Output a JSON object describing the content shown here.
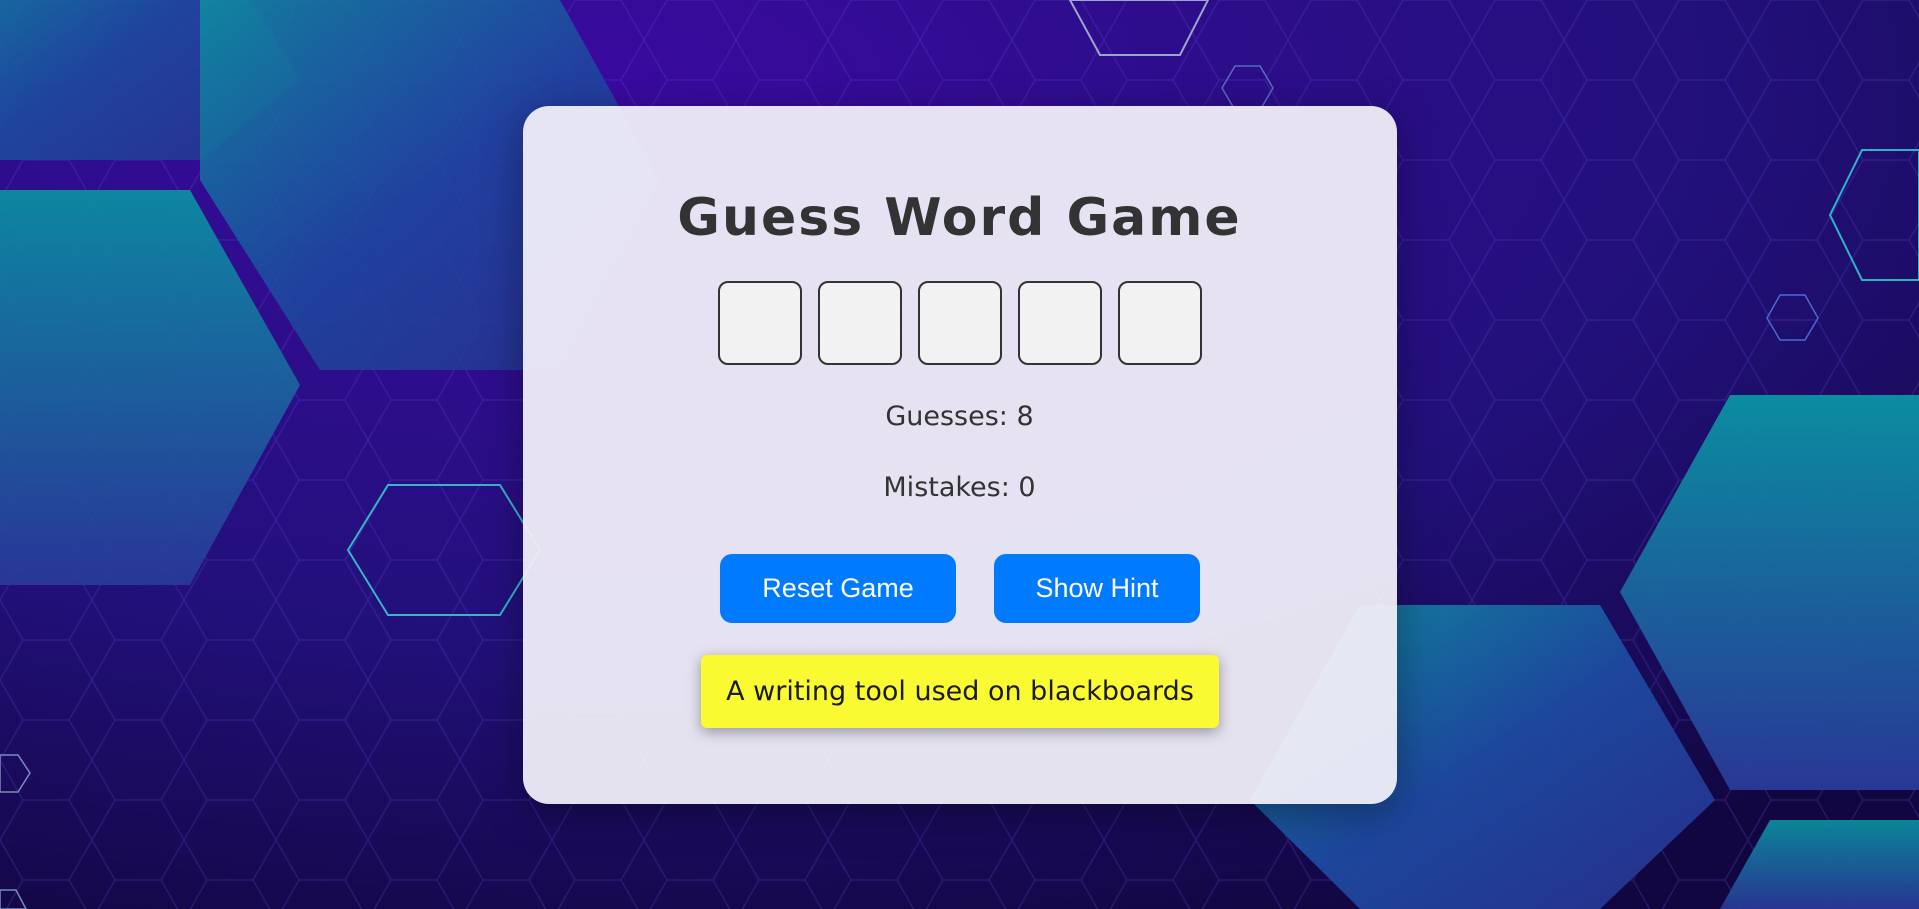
{
  "game": {
    "title": "Guess Word Game",
    "letters": [
      "",
      "",
      "",
      "",
      ""
    ],
    "guesses_text": "Guesses: 8",
    "mistakes_text": "Mistakes: 0",
    "reset_label": "Reset Game",
    "hint_label": "Show Hint",
    "hint_text": "A writing tool used on blackboards"
  },
  "colors": {
    "background": "#23107a",
    "card": "#f0eef8",
    "button": "#007bff",
    "hint_background": "#fafa33",
    "text": "#333333"
  }
}
